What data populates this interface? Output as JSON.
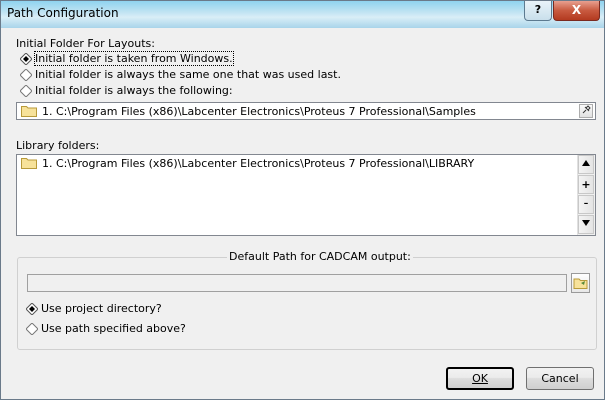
{
  "window": {
    "title": "Path Configuration",
    "help_label": "?",
    "close_label": "X"
  },
  "layouts": {
    "section_label": "Initial Folder For Layouts:",
    "options": [
      {
        "label": "Initial folder is taken from Windows.",
        "selected": true
      },
      {
        "label": "Initial folder is always the same one that was used last.",
        "selected": false
      },
      {
        "label": "Initial folder is always the following:",
        "selected": false
      }
    ],
    "path": "1.   C:\\Program Files (x86)\\Labcenter Electronics\\Proteus 7 Professional\\Samples",
    "path_button_icon": "pin-icon"
  },
  "library": {
    "section_label": "Library folders:",
    "items": [
      {
        "text": "1.   C:\\Program Files (x86)\\Labcenter Electronics\\Proteus 7 Professional\\LIBRARY"
      }
    ],
    "buttons": [
      "up-icon",
      "add-icon",
      "remove-icon",
      "down-icon"
    ]
  },
  "cadcam": {
    "group_title": "Default Path for CADCAM output:",
    "path_value": "",
    "options": [
      {
        "label": "Use project directory?",
        "selected": true
      },
      {
        "label": "Use path specified above?",
        "selected": false
      }
    ]
  },
  "buttons": {
    "ok": "OK",
    "cancel": "Cancel"
  }
}
